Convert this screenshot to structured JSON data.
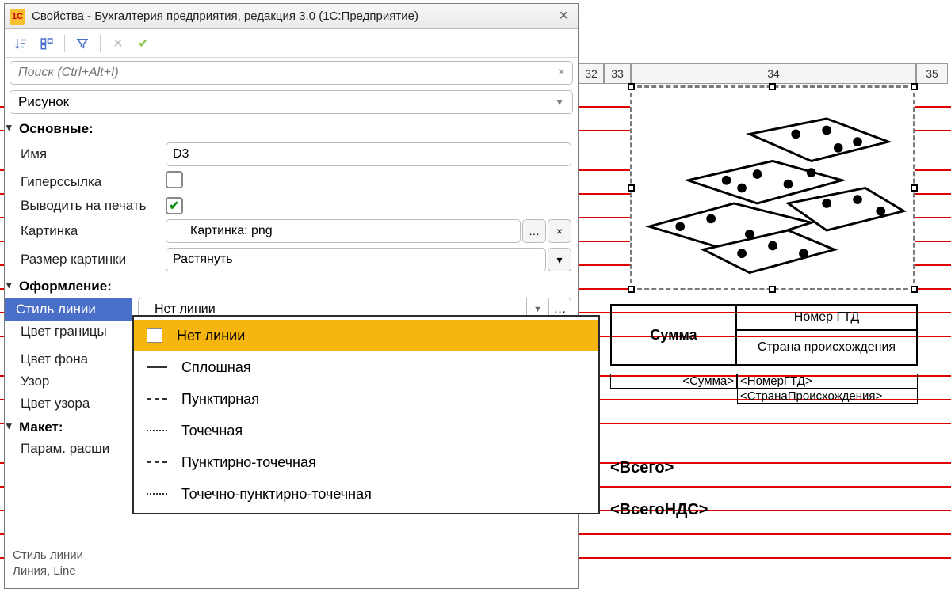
{
  "window": {
    "title": "Свойства - Бухгалтерия предприятия, редакция 3.0  (1С:Предприятие)"
  },
  "search": {
    "placeholder": "Поиск (Ctrl+Alt+I)"
  },
  "typeSelect": {
    "value": "Рисунок"
  },
  "sections": {
    "basic": {
      "header": "Основные:",
      "name_label": "Имя",
      "name_value": "D3",
      "hyperlink_label": "Гиперссылка",
      "print_label": "Выводить на печать",
      "picture_label": "Картинка",
      "picture_value": "Картинка: png",
      "picsize_label": "Размер картинки",
      "picsize_value": "Растянуть"
    },
    "format": {
      "header": "Оформление:",
      "line_style_label": "Стиль линии",
      "line_style_value": "Нет линии",
      "border_color_label": "Цвет границы",
      "bg_color_label": "Цвет фона",
      "pattern_label": "Узор",
      "pattern_color_label": "Цвет узора"
    },
    "layout": {
      "header": "Макет:",
      "param_label": "Парам. расши"
    }
  },
  "dropdown": {
    "options": [
      "Нет линии",
      "Сплошная",
      "Пунктирная",
      "Точечная",
      "Пунктирно-точечная",
      "Точечно-пунктирно-точечная"
    ]
  },
  "footer": {
    "line1": "Стиль линии",
    "line2": "Линия, Line"
  },
  "sheet": {
    "cols": {
      "c32": "32",
      "c33": "33",
      "c34": "34",
      "c35": "35"
    },
    "headers": {
      "sum": "Сумма",
      "gtd": "Номер ГТД",
      "country": "Страна происхождения"
    },
    "placeholders": {
      "sum": "<Сумма>",
      "gtd": "<НомерГТД>",
      "country": "<СтранаПроисхождения>",
      "total": "<Всего>",
      "total_vat": "<ВсегоНДС>"
    }
  }
}
